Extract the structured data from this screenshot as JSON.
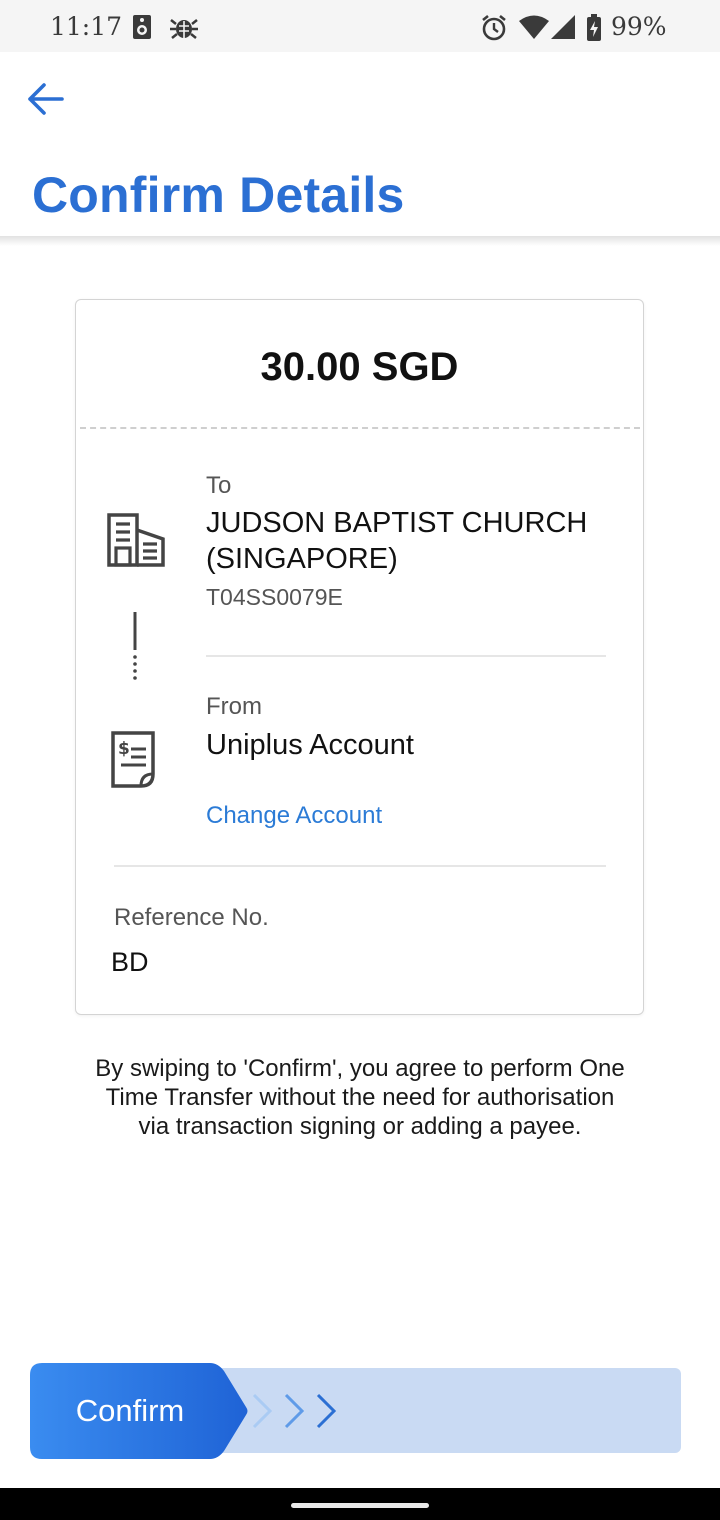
{
  "status_bar": {
    "time": "11:17",
    "battery_percent": "99%",
    "icons": [
      "speaker-icon",
      "bug-icon",
      "alarm-icon",
      "wifi-icon",
      "signal-icon",
      "battery-charging-icon"
    ]
  },
  "header": {
    "title": "Confirm Details",
    "back_icon": "arrow-left-icon"
  },
  "card": {
    "amount": "30.00 SGD",
    "to": {
      "label": "To",
      "name": "JUDSON BAPTIST CHURCH (SINGAPORE)",
      "id": "T04SS0079E",
      "icon": "building-icon"
    },
    "from": {
      "label": "From",
      "account": "Uniplus Account",
      "change_link": "Change Account",
      "icon": "account-statement-icon"
    },
    "reference": {
      "label": "Reference No.",
      "value": "BD"
    }
  },
  "disclaimer": "By swiping to 'Confirm', you agree to perform One Time Transfer without the need for authorisation via transaction signing or adding a payee.",
  "slider": {
    "label": "Confirm",
    "icon": "chevrons-right-icon"
  },
  "colors": {
    "accent": "#2b6fd3",
    "link": "#2b7bd6",
    "slider_track": "#c9daf3",
    "slider_thumb_start": "#3a8cf0",
    "slider_thumb_end": "#1f63d6"
  }
}
